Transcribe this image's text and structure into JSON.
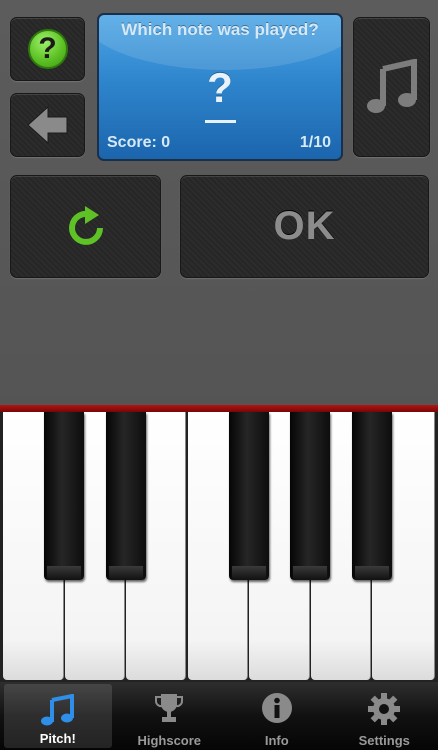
{
  "screen": {
    "question": "Which note was played?",
    "answer": "?",
    "score_text": "Score: 0",
    "progress_text": "1/10"
  },
  "buttons": {
    "help_symbol": "?",
    "ok_label": "OK"
  },
  "tabs": [
    {
      "label": "Pitch!",
      "icon": "music-note-icon",
      "active": true
    },
    {
      "label": "Highscore",
      "icon": "trophy-icon",
      "active": false
    },
    {
      "label": "Info",
      "icon": "info-icon",
      "active": false
    },
    {
      "label": "Settings",
      "icon": "gear-icon",
      "active": false
    }
  ],
  "colors": {
    "accent_green": "#5ec226",
    "screen_blue": "#2f86cd",
    "active_tab_blue": "#2f8fe8",
    "piano_red": "#b01515"
  }
}
